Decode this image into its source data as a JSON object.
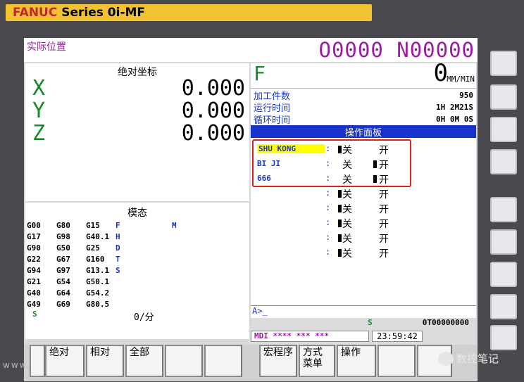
{
  "brand": {
    "name": "FANUC",
    "series": "Series 0i-MF"
  },
  "header": {
    "title": "实际位置",
    "program": "O0000 N00000"
  },
  "absolute": {
    "caption": "绝对坐标",
    "axes": [
      {
        "name": "X",
        "value": "0.000"
      },
      {
        "name": "Y",
        "value": "0.000"
      },
      {
        "name": "Z",
        "value": "0.000"
      }
    ]
  },
  "modal": {
    "caption": "模态",
    "codes": [
      [
        "G00",
        "G80",
        "G15",
        "F"
      ],
      [
        "G17",
        "G98",
        "G40.1",
        "H"
      ],
      [
        "G90",
        "G50",
        "G25",
        "D"
      ],
      [
        "G22",
        "G67",
        "G160",
        "T"
      ],
      [
        "G94",
        "G97",
        "G13.1",
        "S"
      ],
      [
        "G21",
        "G54",
        "G50.1",
        ""
      ],
      [
        "G40",
        "G64",
        "G54.2",
        ""
      ],
      [
        "G49",
        "G69",
        "G80.5",
        ""
      ]
    ],
    "m_label": "M",
    "s_label": "S",
    "rate": "0/分"
  },
  "feed": {
    "label": "F",
    "value": "0",
    "unit": "MM/MIN"
  },
  "counters": [
    {
      "label": "加工件数",
      "value": "950"
    },
    {
      "label": "运行时间",
      "value": "1H 2M21S"
    },
    {
      "label": "循环时间",
      "value": "0H 0M 0S"
    }
  ],
  "panel": {
    "title": "操作面板",
    "rows": [
      {
        "label": "SHU KONG",
        "selected": true,
        "off": "关",
        "on": "开",
        "state": "off"
      },
      {
        "label": "BI JI",
        "selected": false,
        "off": "关",
        "on": "开",
        "state": "on"
      },
      {
        "label": "666",
        "selected": false,
        "off": "关",
        "on": "开",
        "state": "on"
      },
      {
        "label": "",
        "selected": false,
        "off": "关",
        "on": "开",
        "state": "off"
      },
      {
        "label": "",
        "selected": false,
        "off": "关",
        "on": "开",
        "state": "off"
      },
      {
        "label": "",
        "selected": false,
        "off": "关",
        "on": "开",
        "state": "off"
      },
      {
        "label": "",
        "selected": false,
        "off": "关",
        "on": "开",
        "state": "off"
      },
      {
        "label": "",
        "selected": false,
        "off": "关",
        "on": "开",
        "state": "off"
      }
    ]
  },
  "command_line": "A>_",
  "status": {
    "s_label": "S",
    "s_value": "0T00000000",
    "mode": "MDI **** *** ***",
    "time": "23:59:42"
  },
  "softkeys": [
    "",
    "绝对",
    "相对",
    "全部",
    "",
    "",
    "宏程序",
    "方式\n菜单",
    "操作",
    "",
    ""
  ],
  "watermark": "数控笔记",
  "watermark_left": "www."
}
